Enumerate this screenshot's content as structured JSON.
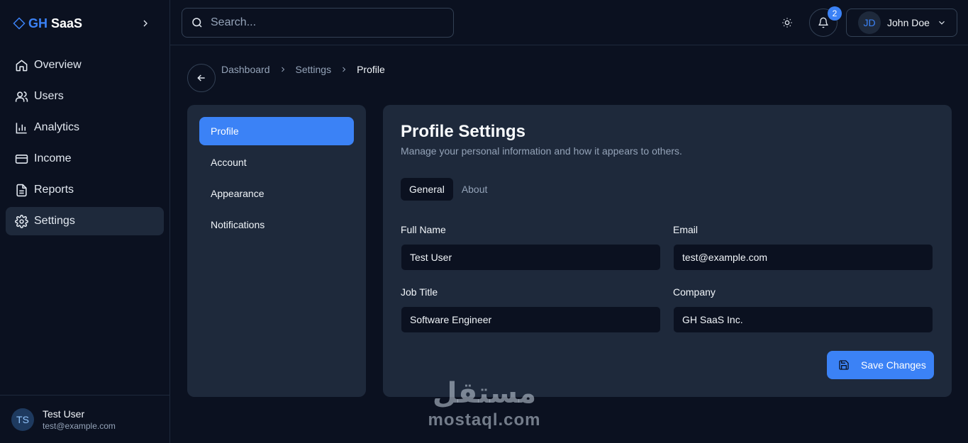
{
  "brand": {
    "prefix": "GH",
    "name": "SaaS"
  },
  "sidebar": {
    "items": [
      {
        "label": "Overview",
        "icon": "home-icon"
      },
      {
        "label": "Users",
        "icon": "users-icon"
      },
      {
        "label": "Analytics",
        "icon": "bar-chart-icon"
      },
      {
        "label": "Income",
        "icon": "credit-card-icon"
      },
      {
        "label": "Reports",
        "icon": "document-icon"
      },
      {
        "label": "Settings",
        "icon": "gear-icon",
        "active": true
      }
    ],
    "user": {
      "initials": "TS",
      "name": "Test User",
      "email": "test@example.com"
    }
  },
  "topbar": {
    "search_placeholder": "Search...",
    "notification_count": "2",
    "user": {
      "initials": "JD",
      "name": "John Doe"
    }
  },
  "breadcrumb": [
    "Dashboard",
    "Settings",
    "Profile"
  ],
  "settings_nav": [
    {
      "label": "Profile",
      "active": true
    },
    {
      "label": "Account"
    },
    {
      "label": "Appearance"
    },
    {
      "label": "Notifications"
    }
  ],
  "profile": {
    "title": "Profile Settings",
    "subtitle": "Manage your personal information and how it appears to others.",
    "tabs": [
      {
        "label": "General",
        "active": true
      },
      {
        "label": "About"
      }
    ],
    "fields": {
      "full_name": {
        "label": "Full Name",
        "value": "Test User"
      },
      "email": {
        "label": "Email",
        "value": "test@example.com"
      },
      "job_title": {
        "label": "Job Title",
        "value": "Software Engineer"
      },
      "company": {
        "label": "Company",
        "value": "GH SaaS Inc."
      }
    },
    "save_label": "Save Changes"
  },
  "watermark": {
    "arabic": "مستقل",
    "latin": "mostaql.com"
  },
  "colors": {
    "accent": "#3b82f6",
    "background": "#0b1120",
    "card": "#1e293b"
  }
}
